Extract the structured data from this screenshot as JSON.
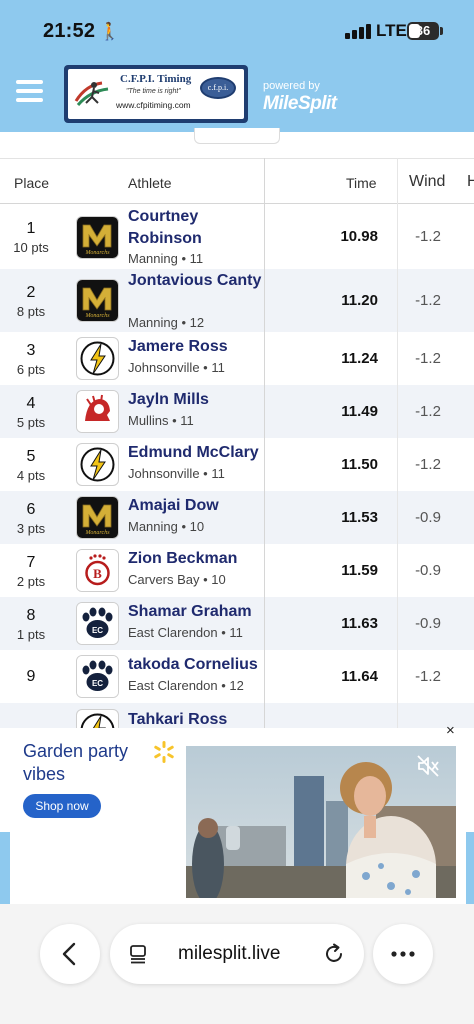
{
  "status_bar": {
    "time": "21:52",
    "person_glyph": "🚶",
    "network": "LTE",
    "battery": "36"
  },
  "header": {
    "logo": {
      "title": "C.F.P.I. Timing",
      "tagline": "\"The time is right\"",
      "url": "www.cfpitiming.com",
      "badge": "c.f.p.i."
    },
    "powered_by": "powered by",
    "brand": "MileSplit"
  },
  "table": {
    "headers": {
      "place": "Place",
      "athlete": "Athlete",
      "time": "Time",
      "wind": "Wind",
      "extra": "H"
    },
    "rows": [
      {
        "place": "1",
        "pts": "10 pts",
        "name": "Courtney Robinson",
        "team": "Manning • 11",
        "mark": "10.98",
        "wind": "-1.2",
        "logo": "manning"
      },
      {
        "place": "2",
        "pts": "8 pts",
        "name": "Jontavious Canty",
        "team": "Manning • 12",
        "mark": "11.20",
        "wind": "-1.2",
        "logo": "manning"
      },
      {
        "place": "3",
        "pts": "6 pts",
        "name": "Jamere Ross",
        "team": "Johnsonville • 11",
        "mark": "11.24",
        "wind": "-1.2",
        "logo": "johnsonville"
      },
      {
        "place": "4",
        "pts": "5 pts",
        "name": "Jayln Mills",
        "team": "Mullins • 11",
        "mark": "11.49",
        "wind": "-1.2",
        "logo": "mullins"
      },
      {
        "place": "5",
        "pts": "4 pts",
        "name": "Edmund McClary",
        "team": "Johnsonville • 11",
        "mark": "11.50",
        "wind": "-1.2",
        "logo": "johnsonville"
      },
      {
        "place": "6",
        "pts": "3 pts",
        "name": "Amajai Dow",
        "team": "Manning • 10",
        "mark": "11.53",
        "wind": "-0.9",
        "logo": "manning"
      },
      {
        "place": "7",
        "pts": "2 pts",
        "name": "Zion Beckman",
        "team": "Carvers Bay • 10",
        "mark": "11.59",
        "wind": "-0.9",
        "logo": "carvers-bay"
      },
      {
        "place": "8",
        "pts": "1 pts",
        "name": "Shamar Graham",
        "team": "East Clarendon • 11",
        "mark": "11.63",
        "wind": "-0.9",
        "logo": "east-clarendon"
      },
      {
        "place": "9",
        "pts": "",
        "name": "takoda Cornelius",
        "team": "East Clarendon • 12",
        "mark": "11.64",
        "wind": "-1.2",
        "logo": "east-clarendon"
      },
      {
        "place": "",
        "pts": "",
        "name": "Tahkari Ross",
        "team": "",
        "mark": "",
        "wind": "",
        "logo": "johnsonville"
      }
    ]
  },
  "ad": {
    "close_glyph": "×",
    "headline": "Garden party vibes",
    "cta": "Shop now"
  },
  "browser": {
    "url": "milesplit.live"
  },
  "colors": {
    "header_bg": "#8ec9ee",
    "athlete_name": "#1f2a6e",
    "ad_blue": "#2563c9"
  }
}
